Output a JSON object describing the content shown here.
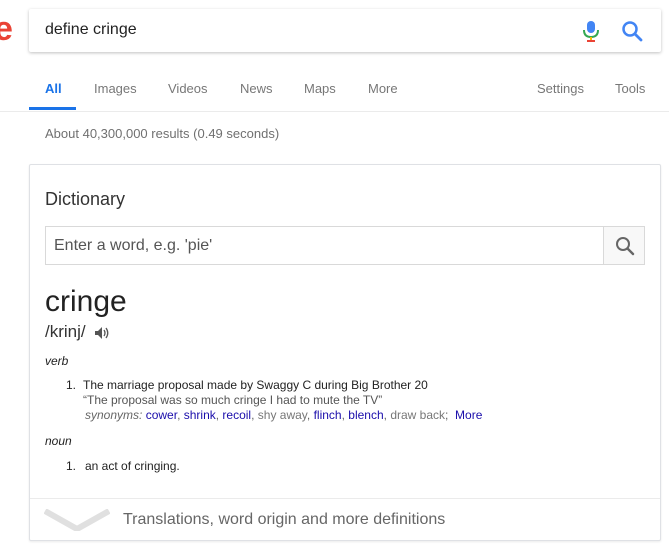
{
  "logo": {
    "fragment": "e"
  },
  "search": {
    "query": "define cringe",
    "mic_icon": "mic-icon",
    "search_icon": "search-icon"
  },
  "tabs": {
    "items": [
      "All",
      "Images",
      "Videos",
      "News",
      "Maps",
      "More"
    ],
    "settings": "Settings",
    "tools": "Tools",
    "active": "All"
  },
  "stats": {
    "text": "About 40,300,000 results (0.49 seconds)"
  },
  "dictionary": {
    "title": "Dictionary",
    "input_placeholder": "Enter a word, e.g. 'pie'",
    "word": "cringe",
    "phonetic": "/krinj/",
    "senses": [
      {
        "pos": "verb",
        "definitions": [
          {
            "num": "1.",
            "text": "The marriage proposal made by Swaggy C during Big Brother 20",
            "example": "“The proposal was so much cringe I had to mute the TV”",
            "synonyms_label": "synonyms:",
            "synonyms_linked": [
              "cower",
              "shrink",
              "recoil"
            ],
            "synonym_plain_1": "shy away",
            "synonyms_linked_2": [
              "flinch",
              "blench"
            ],
            "synonym_plain_2": "draw back",
            "more": "More"
          }
        ]
      },
      {
        "pos": "noun",
        "definitions": [
          {
            "num": "1.",
            "text": "an act of cringing."
          }
        ]
      }
    ],
    "footer_text": "Translations, word origin and more definitions"
  },
  "colors": {
    "accent": "#1a73e8",
    "link": "#1a0dab",
    "logo_red": "#ea4335"
  }
}
